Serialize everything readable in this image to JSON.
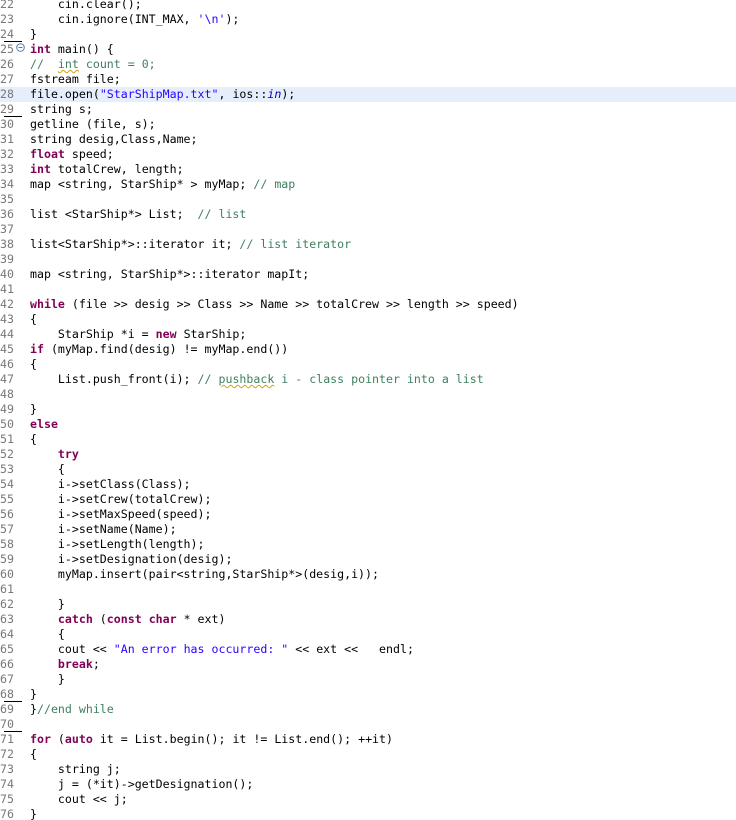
{
  "editor": {
    "lines": [
      {
        "n": "22",
        "t": "    cin.clear();"
      },
      {
        "n": "23",
        "t": "    cin.ignore(INT_MAX, '\\n');"
      },
      {
        "n": "24",
        "t": "}"
      },
      {
        "n": "25",
        "t": "int main() {"
      },
      {
        "n": "26",
        "t": "//  int count = 0;"
      },
      {
        "n": "27",
        "t": "fstream file;"
      },
      {
        "n": "28",
        "t": "file.open(\"StarShipMap.txt\", ios::in);"
      },
      {
        "n": "29",
        "t": "string s;"
      },
      {
        "n": "30",
        "t": "getline (file, s);"
      },
      {
        "n": "31",
        "t": "string desig,Class,Name;"
      },
      {
        "n": "32",
        "t": "float speed;"
      },
      {
        "n": "33",
        "t": "int totalCrew, length;"
      },
      {
        "n": "34",
        "t": "map <string, StarShip* > myMap; // map"
      },
      {
        "n": "35",
        "t": ""
      },
      {
        "n": "36",
        "t": "list <StarShip*> List;  // list"
      },
      {
        "n": "37",
        "t": ""
      },
      {
        "n": "38",
        "t": "list<StarShip*>::iterator it; // list iterator"
      },
      {
        "n": "39",
        "t": ""
      },
      {
        "n": "40",
        "t": "map <string, StarShip*>::iterator mapIt;"
      },
      {
        "n": "41",
        "t": ""
      },
      {
        "n": "42",
        "t": "while (file >> desig >> Class >> Name >> totalCrew >> length >> speed)"
      },
      {
        "n": "43",
        "t": "{"
      },
      {
        "n": "44",
        "t": "    StarShip *i = new StarShip;"
      },
      {
        "n": "45",
        "t": "if (myMap.find(desig) != myMap.end())"
      },
      {
        "n": "46",
        "t": "{"
      },
      {
        "n": "47",
        "t": "    List.push_front(i); // pushback i - class pointer into a list"
      },
      {
        "n": "48",
        "t": ""
      },
      {
        "n": "49",
        "t": "}"
      },
      {
        "n": "50",
        "t": "else"
      },
      {
        "n": "51",
        "t": "{"
      },
      {
        "n": "52",
        "t": "    try"
      },
      {
        "n": "53",
        "t": "    {"
      },
      {
        "n": "54",
        "t": "    i->setClass(Class);"
      },
      {
        "n": "55",
        "t": "    i->setCrew(totalCrew);"
      },
      {
        "n": "56",
        "t": "    i->setMaxSpeed(speed);"
      },
      {
        "n": "57",
        "t": "    i->setName(Name);"
      },
      {
        "n": "58",
        "t": "    i->setLength(length);"
      },
      {
        "n": "59",
        "t": "    i->setDesignation(desig);"
      },
      {
        "n": "60",
        "t": "    myMap.insert(pair<string,StarShip*>(desig,i));"
      },
      {
        "n": "61",
        "t": ""
      },
      {
        "n": "62",
        "t": "    }"
      },
      {
        "n": "63",
        "t": "    catch (const char * ext)"
      },
      {
        "n": "64",
        "t": "    {"
      },
      {
        "n": "65",
        "t": "    cout << \"An error has occurred: \" << ext <<   endl;"
      },
      {
        "n": "66",
        "t": "    break;"
      },
      {
        "n": "67",
        "t": "    }"
      },
      {
        "n": "68",
        "t": "}"
      },
      {
        "n": "69",
        "t": "}//end while"
      },
      {
        "n": "70",
        "t": ""
      },
      {
        "n": "71",
        "t": "for (auto it = List.begin(); it != List.end(); ++it)"
      },
      {
        "n": "72",
        "t": "{"
      },
      {
        "n": "73",
        "t": "    string j;"
      },
      {
        "n": "74",
        "t": "    j = (*it)->getDesignation();"
      },
      {
        "n": "75",
        "t": "    cout << j;"
      },
      {
        "n": "76",
        "t": "}"
      }
    ],
    "fold_icon": "collapse-minus-icon",
    "colors": {
      "keyword": "#7f0055",
      "string": "#2a00ff",
      "comment": "#3f7f5f",
      "type": "#005032",
      "line_number": "#787878",
      "current_line": "#e6eefc"
    }
  }
}
